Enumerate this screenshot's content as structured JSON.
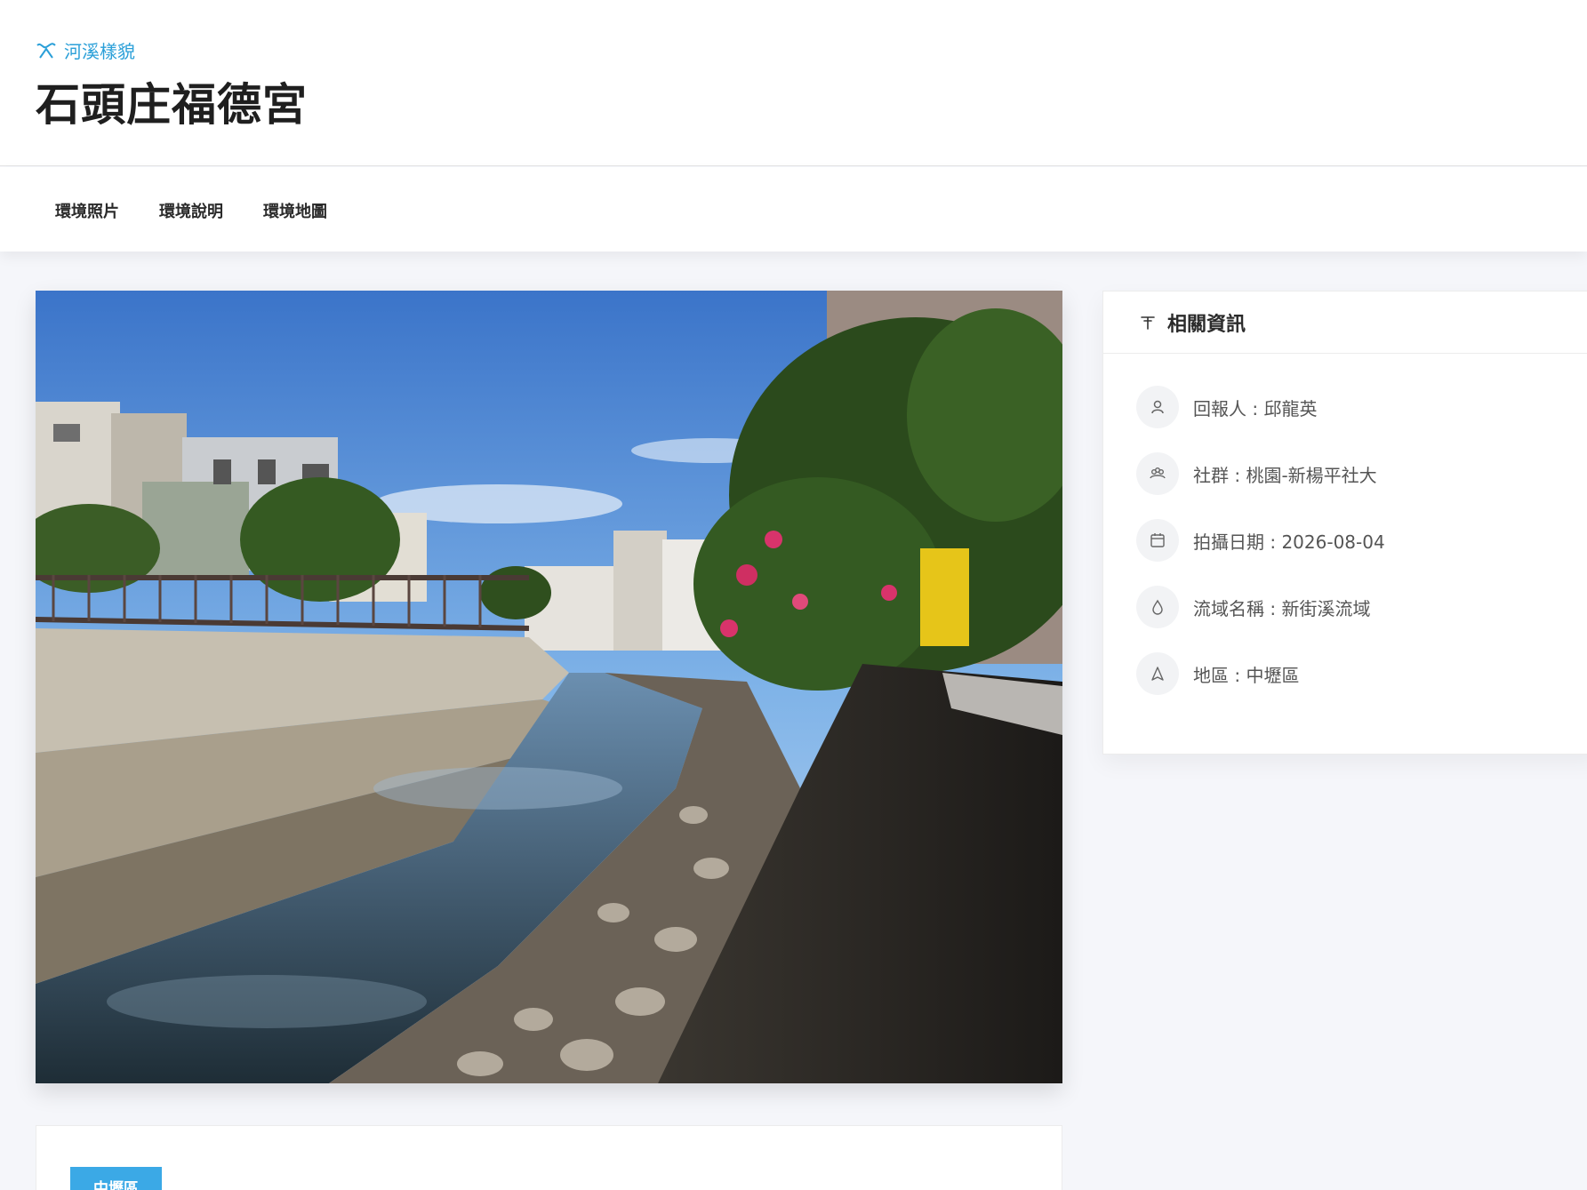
{
  "header": {
    "category": "河溪樣貌",
    "title": "石頭庄福德宮"
  },
  "tabs": [
    {
      "label": "環境照片"
    },
    {
      "label": "環境說明"
    },
    {
      "label": "環境地圖"
    }
  ],
  "info": {
    "title": "相關資訊",
    "rows": [
      {
        "icon": "user-icon",
        "label": "回報人",
        "value": "邱龍英"
      },
      {
        "icon": "group-icon",
        "label": "社群",
        "value": "桃園-新楊平社大"
      },
      {
        "icon": "calendar-icon",
        "label": "拍攝日期",
        "value": "2026-08-04"
      },
      {
        "icon": "water-drop-icon",
        "label": "流域名稱",
        "value": "新街溪流域"
      },
      {
        "icon": "navigation-icon",
        "label": "地區",
        "value": "中壢區"
      }
    ]
  },
  "description": {
    "area_badge": "中壢區"
  },
  "colors": {
    "accent": "#2a9fd8",
    "badge": "#3ba9e6"
  }
}
